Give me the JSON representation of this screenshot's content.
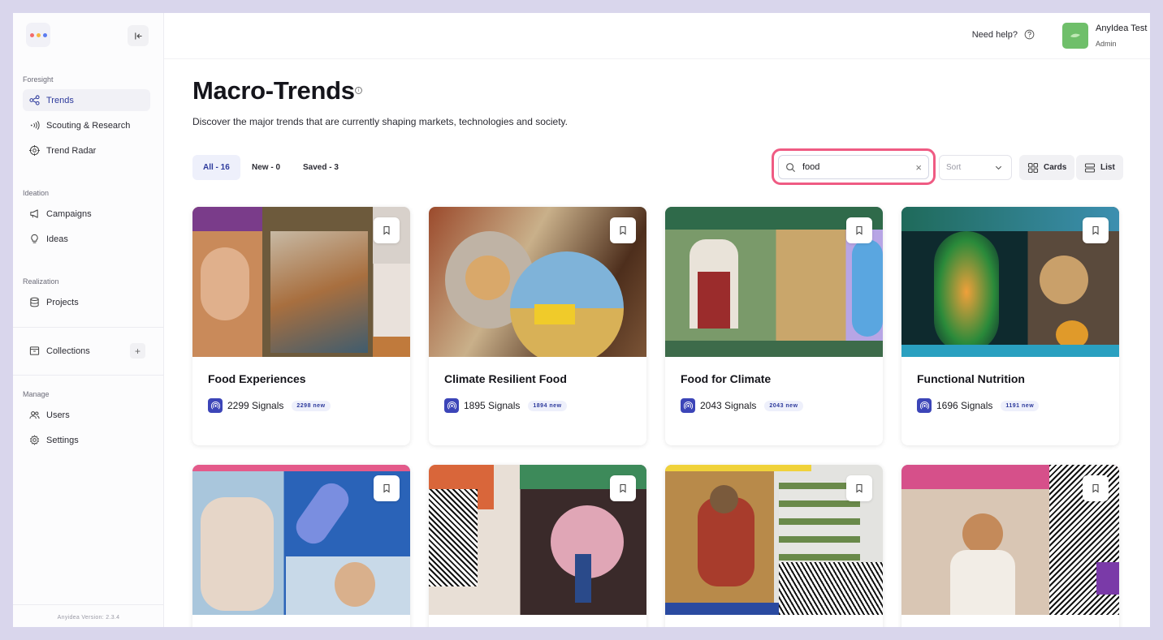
{
  "sidebar": {
    "sections": [
      {
        "label": "Foresight",
        "items": [
          {
            "label": "Trends",
            "icon": "share-nodes-icon",
            "active": true
          },
          {
            "label": "Scouting & Research",
            "icon": "broadcast-icon"
          },
          {
            "label": "Trend Radar",
            "icon": "radar-icon"
          }
        ]
      },
      {
        "label": "Ideation",
        "items": [
          {
            "label": "Campaigns",
            "icon": "megaphone-icon"
          },
          {
            "label": "Ideas",
            "icon": "lightbulb-icon"
          }
        ]
      },
      {
        "label": "Realization",
        "items": [
          {
            "label": "Projects",
            "icon": "database-icon"
          }
        ]
      },
      {
        "label": "Manage",
        "items": [
          {
            "label": "Users",
            "icon": "users-icon"
          },
          {
            "label": "Settings",
            "icon": "gear-icon"
          }
        ]
      }
    ],
    "collections_label": "Collections",
    "collections_add": "+",
    "version": "Anyidea Version: 2.3.4"
  },
  "topbar": {
    "help_label": "Need help?",
    "user_name": "AnyIdea Test",
    "user_role": "Admin"
  },
  "page": {
    "title": "Macro-Trends",
    "info_mark": "i",
    "subtitle": "Discover the major trends that are currently shaping markets, technologies and society."
  },
  "filters": {
    "tabs": [
      {
        "label": "All - 16",
        "active": true
      },
      {
        "label": "New - 0",
        "active": false
      },
      {
        "label": "Saved - 3",
        "active": false
      }
    ],
    "search_value": "food",
    "clear_glyph": "×",
    "sort_placeholder": "Sort",
    "view_cards": "Cards",
    "view_list": "List"
  },
  "cards": [
    {
      "title": "Food Experiences",
      "signals": "2299 Signals",
      "new_badge": "2298 new"
    },
    {
      "title": "Climate Resilient Food",
      "signals": "1895 Signals",
      "new_badge": "1894 new"
    },
    {
      "title": "Food for Climate",
      "signals": "2043 Signals",
      "new_badge": "2043 new"
    },
    {
      "title": "Functional Nutrition",
      "signals": "1696 Signals",
      "new_badge": "1191 new"
    },
    {
      "title": "",
      "signals": "",
      "new_badge": ""
    },
    {
      "title": "",
      "signals": "",
      "new_badge": ""
    },
    {
      "title": "",
      "signals": "",
      "new_badge": ""
    },
    {
      "title": "",
      "signals": "",
      "new_badge": ""
    }
  ],
  "colors": {
    "accent": "#2d3a9c",
    "highlight": "#ef5b83",
    "signal_icon": "#3c45b8",
    "avatar": "#6fbf6a",
    "frame": "#d9d6ec"
  }
}
